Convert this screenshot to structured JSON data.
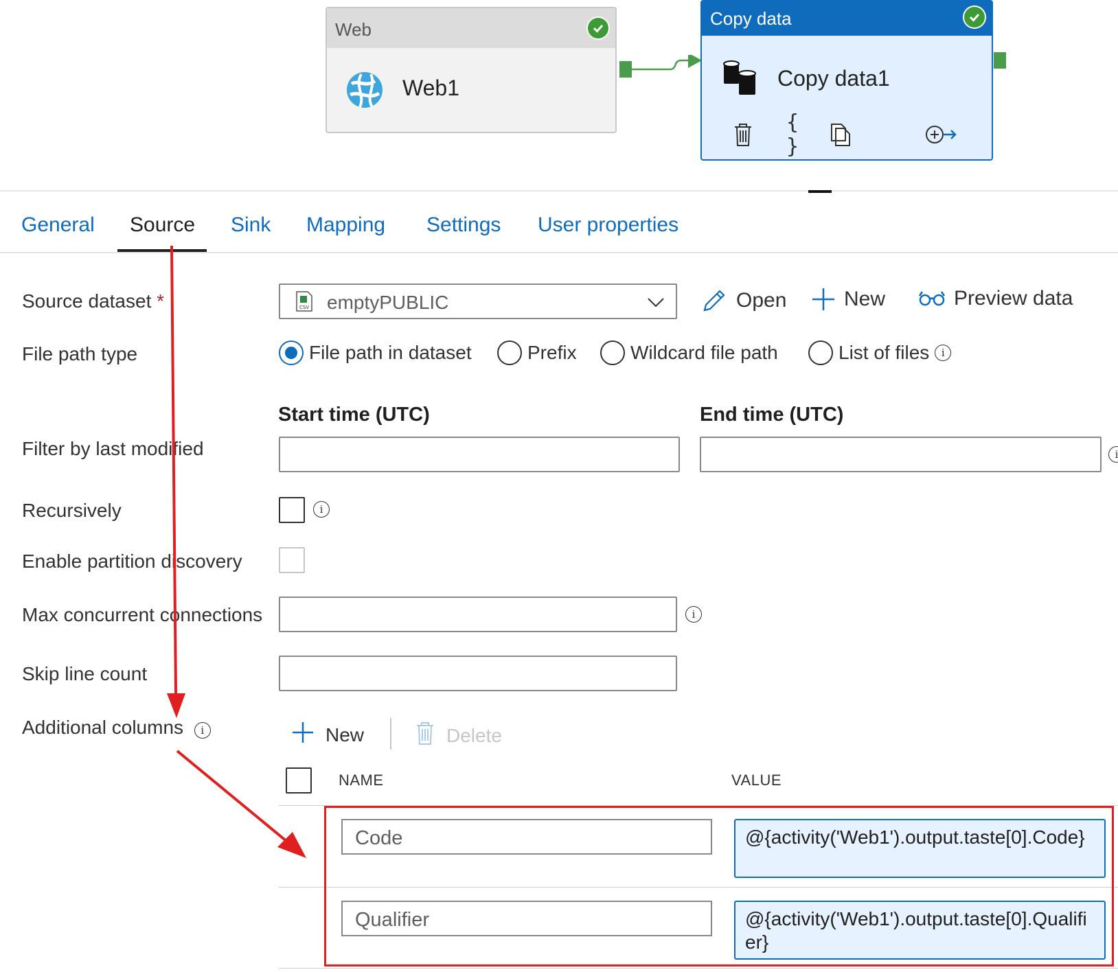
{
  "canvas": {
    "web_activity": {
      "type_label": "Web",
      "name": "Web1"
    },
    "copy_activity": {
      "type_label": "Copy data",
      "name": "Copy data1"
    }
  },
  "tabs": [
    "General",
    "Source",
    "Sink",
    "Mapping",
    "Settings",
    "User properties"
  ],
  "active_tab": "Source",
  "form": {
    "source_dataset": {
      "label": "Source dataset",
      "required_mark": "*",
      "value": "emptyPUBLIC"
    },
    "dataset_actions": {
      "open": "Open",
      "new": "New",
      "preview": "Preview data"
    },
    "file_path_type": {
      "label": "File path type",
      "options": [
        "File path in dataset",
        "Prefix",
        "Wildcard file path",
        "List of files"
      ],
      "selected": "File path in dataset"
    },
    "filter_by_last_modified": {
      "label": "Filter by last modified",
      "start_label": "Start time (UTC)",
      "end_label": "End time (UTC)",
      "start_value": "",
      "end_value": ""
    },
    "recursively": {
      "label": "Recursively",
      "checked": false
    },
    "partition_discovery": {
      "label": "Enable partition discovery",
      "checked": false
    },
    "max_connections": {
      "label": "Max concurrent connections",
      "value": ""
    },
    "skip_line_count": {
      "label": "Skip line count",
      "value": ""
    },
    "additional_columns": {
      "label": "Additional columns",
      "new_label": "New",
      "delete_label": "Delete",
      "headers": {
        "name": "NAME",
        "value": "VALUE"
      },
      "rows": [
        {
          "name": "Code",
          "value": "@{activity('Web1').output.taste[0].Code}"
        },
        {
          "name": "Qualifier",
          "value": "@{activity('Web1').output.taste[0].Qualifier}"
        }
      ]
    }
  },
  "colors": {
    "accent": "#0f6cbd",
    "success": "#3d9b35",
    "annotation": "#e02020",
    "port": "#4a9c4a"
  }
}
